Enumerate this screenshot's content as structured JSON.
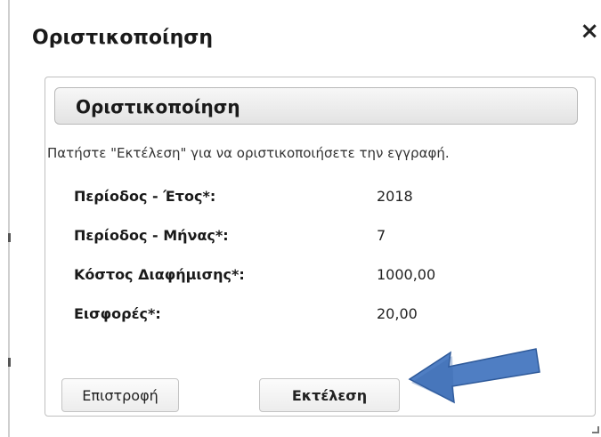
{
  "dialog": {
    "title": "Οριστικοποίηση",
    "close_glyph": "×"
  },
  "panel": {
    "header_title": "Οριστικοποίηση",
    "instruction": "Πατήστε \"Εκτέλεση\" για να οριστικοποιήσετε την εγγραφή.",
    "fields": [
      {
        "label": "Περίοδος - Έτος*:",
        "value": "2018"
      },
      {
        "label": "Περίοδος - Μήνας*:",
        "value": "7"
      },
      {
        "label": "Κόστος Διαφήμισης*:",
        "value": "1000,00"
      },
      {
        "label": "Εισφορές*:",
        "value": "20,00"
      }
    ]
  },
  "buttons": {
    "back_label": "Επιστροφή",
    "run_label": "Εκτέλεση"
  },
  "annotation": {
    "arrow_color": "#4f7ec3"
  }
}
